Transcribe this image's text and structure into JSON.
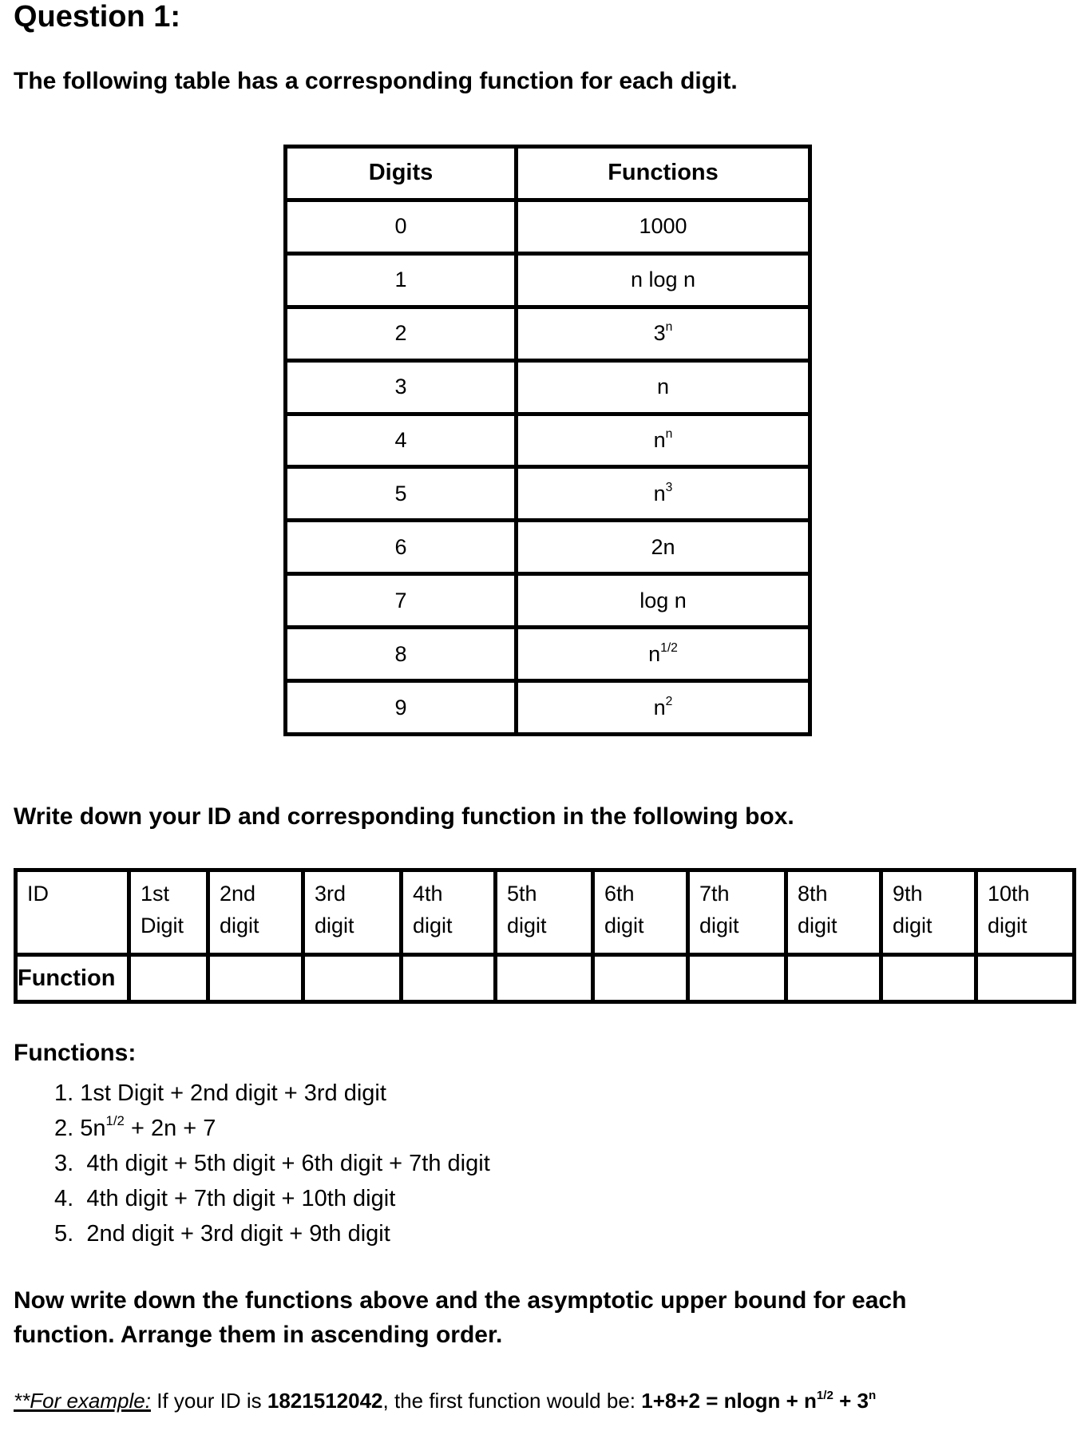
{
  "heading": "Question 1:",
  "intro": "The following table has a corresponding function for each digit.",
  "digit_table": {
    "headers": [
      "Digits",
      "Functions"
    ],
    "rows": [
      {
        "digit": "0",
        "base": "1000",
        "sup": ""
      },
      {
        "digit": "1",
        "base": "n log n",
        "sup": ""
      },
      {
        "digit": "2",
        "base": "3",
        "sup": "n"
      },
      {
        "digit": "3",
        "base": "n",
        "sup": ""
      },
      {
        "digit": "4",
        "base": "n",
        "sup": "n"
      },
      {
        "digit": "5",
        "base": "n",
        "sup": "3"
      },
      {
        "digit": "6",
        "base": "2n",
        "sup": ""
      },
      {
        "digit": "7",
        "base": "log n",
        "sup": ""
      },
      {
        "digit": "8",
        "base": "n",
        "sup": "1/2"
      },
      {
        "digit": "9",
        "base": "n",
        "sup": "2"
      }
    ]
  },
  "instruction": "Write down your ID and corresponding function in the following box.",
  "id_table": {
    "row_label_id": "ID",
    "row_label_function": "Function",
    "columns": [
      {
        "line1": "1st",
        "line2": "Digit"
      },
      {
        "line1": "2nd",
        "line2": "digit"
      },
      {
        "line1": "3rd",
        "line2": "digit"
      },
      {
        "line1": "4th",
        "line2": "digit"
      },
      {
        "line1": "5th",
        "line2": "digit"
      },
      {
        "line1": "6th",
        "line2": "digit"
      },
      {
        "line1": "7th",
        "line2": "digit"
      },
      {
        "line1": "8th",
        "line2": "digit"
      },
      {
        "line1": "9th",
        "line2": "digit"
      },
      {
        "line1": "10th",
        "line2": "digit"
      }
    ],
    "function_values": [
      "",
      "",
      "",
      "",
      "",
      "",
      "",
      "",
      "",
      ""
    ]
  },
  "functions": {
    "title": "Functions:",
    "items": [
      {
        "num": "1. ",
        "text": "1st Digit + 2nd digit + 3rd digit"
      },
      {
        "num": "2. ",
        "pre": "5n",
        "sup": "1/2",
        "post": " + 2n + 7"
      },
      {
        "num": "3.  ",
        "text": "4th digit + 5th digit + 6th digit + 7th digit"
      },
      {
        "num": "4.  ",
        "text": "4th digit + 7th digit + 10th digit"
      },
      {
        "num": "5.  ",
        "text": "2nd digit + 3rd digit + 9th digit"
      }
    ]
  },
  "task": {
    "line1": "Now write down the functions above and the asymptotic upper bound for each",
    "line2": "function. Arrange them in ascending order."
  },
  "example": {
    "lead": "**For example:",
    "t1": " If your ID is ",
    "id": "1821512042",
    "t2": ", the first function would be: ",
    "expr": "1+8+2 = nlogn + n",
    "expr_sup": "1/2",
    "expr2": " + 3",
    "expr2_sup": "n"
  }
}
